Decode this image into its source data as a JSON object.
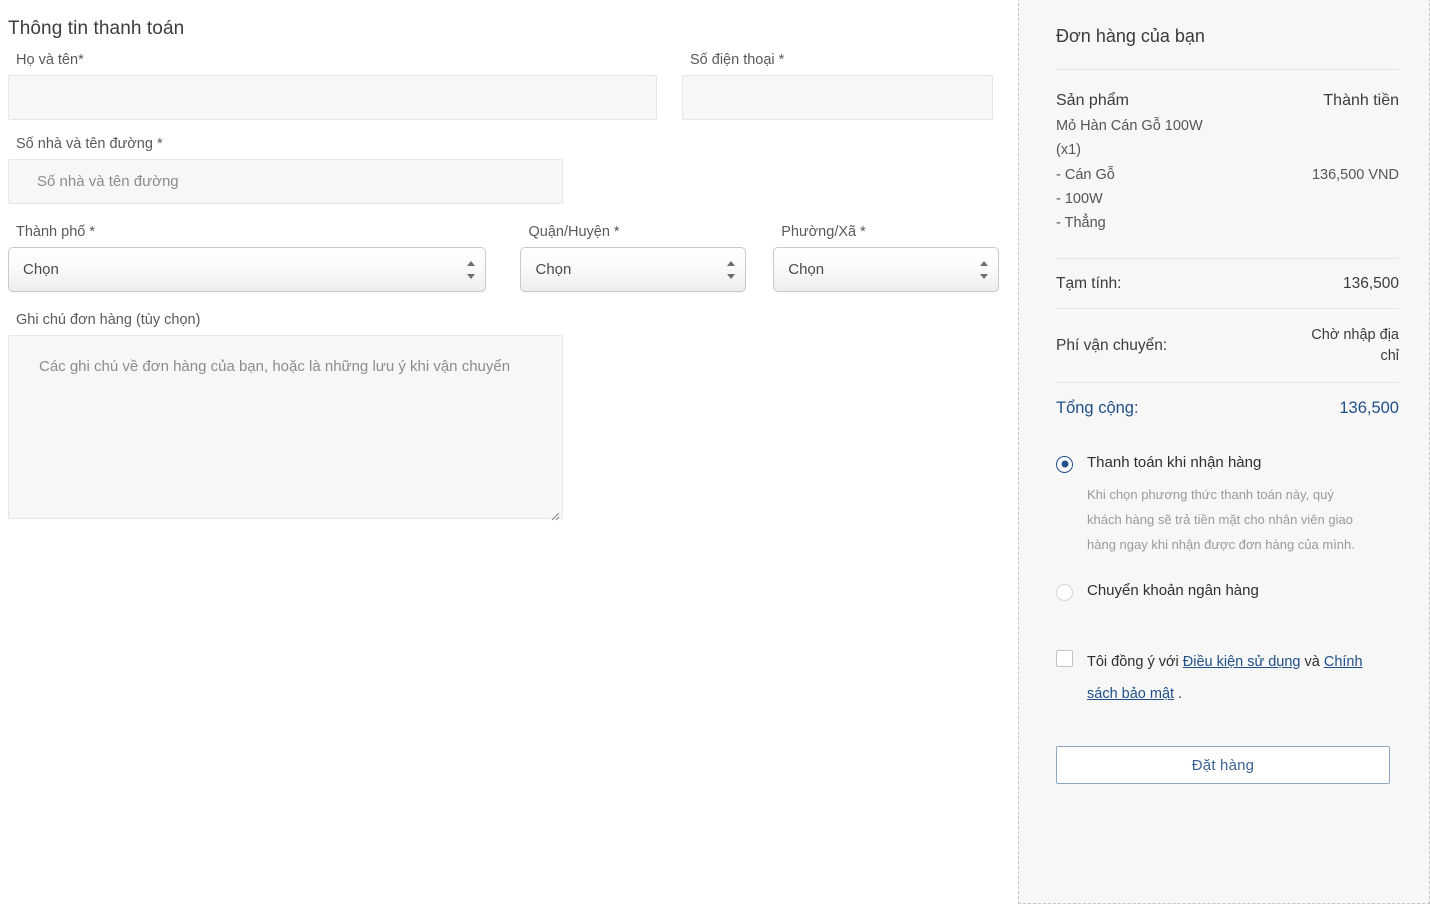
{
  "billing": {
    "section_title": "Thông tin thanh toán",
    "fields": {
      "fullname_label": "Họ và tên*",
      "fullname_value": "",
      "fullname_placeholder": "",
      "phone_label": "Số điện thoại *",
      "phone_value": "",
      "phone_placeholder": "",
      "street_label": "Số nhà và tên đường *",
      "street_value": "",
      "street_placeholder": "Số nhà và tên đường",
      "city_label": "Thành phố *",
      "city_selected": "Chọn",
      "district_label": "Quận/Huyện *",
      "district_selected": "Chọn",
      "ward_label": "Phường/Xã *",
      "ward_selected": "Chọn",
      "notes_label": "Ghi chú đơn hàng (tùy chọn)",
      "notes_value": "",
      "notes_placeholder": "Các ghi chú về đơn hàng của bạn, hoặc là những lưu ý khi vận chuyển"
    },
    "select_options": [
      "Chọn"
    ]
  },
  "order": {
    "panel_title": "Đơn hàng của bạn",
    "col_product": "Sản phẩm",
    "col_total": "Thành tiền",
    "items": [
      {
        "name": "Mỏ Hàn Cán Gỗ 100W\n(x1)\n- Cán Gỗ\n- 100W\n- Thẳng",
        "total": "136,500 VND"
      }
    ],
    "subtotal_label": "Tạm tính:",
    "subtotal_value": "136,500",
    "shipping_label": "Phí vận chuyển:",
    "shipping_value": "Chờ nhập địa chỉ",
    "grand_label": "Tổng cộng:",
    "grand_value": "136,500",
    "payment_methods": [
      {
        "label": "Thanh toán khi nhận hàng",
        "selected": true,
        "description": "Khi chọn phương thức thanh toán này, quý khách hàng sẽ trả tiền mặt cho nhân viên giao hàng ngay khi nhận được đơn hàng của mình."
      },
      {
        "label": "Chuyển khoản ngân hàng",
        "selected": false,
        "description": ""
      }
    ],
    "terms": {
      "prefix": "Tôi đồng ý với ",
      "link1": "Điều kiện sử dụng",
      "middle": " và ",
      "link2": "Chính sách bảo mật",
      "suffix": " .",
      "checked": false
    },
    "submit_label": "Đặt hàng"
  },
  "colors": {
    "accent_blue": "#215089",
    "button_border": "#8fa9c4",
    "button_text": "#3c6394",
    "field_bg": "#f7f7f7",
    "panel_bg": "#f7f7f7",
    "panel_border": "#c6c6c6"
  }
}
